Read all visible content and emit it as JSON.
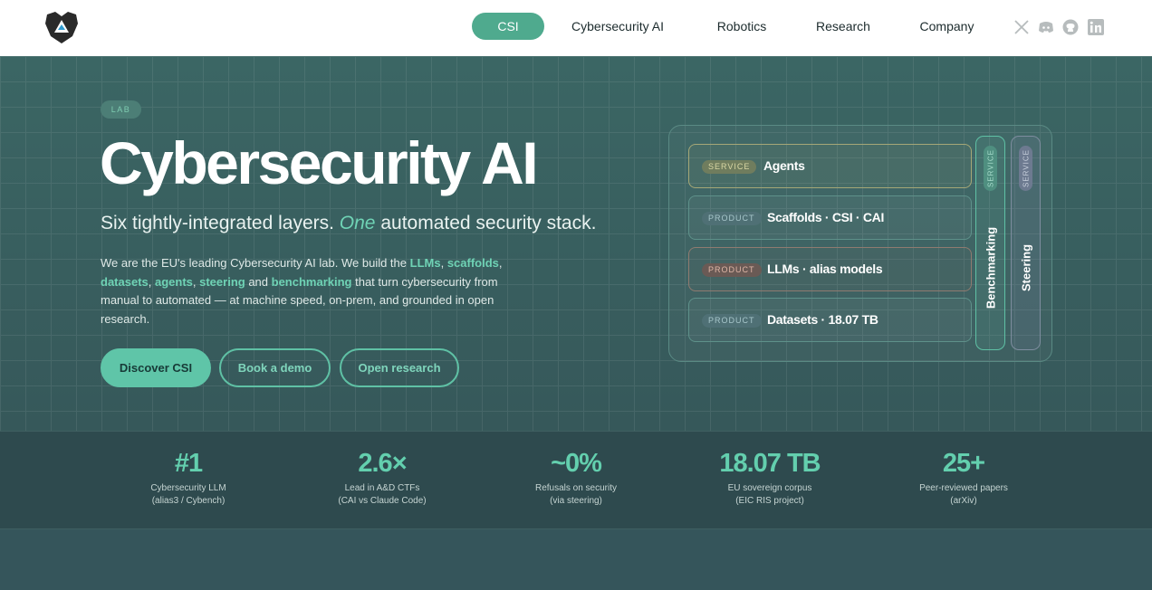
{
  "nav": {
    "items": [
      "CSI",
      "Cybersecurity AI",
      "Robotics",
      "Research",
      "Company"
    ],
    "active": "CSI"
  },
  "social": [
    "x-icon",
    "discord-icon",
    "github-icon",
    "linkedin-icon"
  ],
  "hero": {
    "badge": "LAB",
    "title": "Cybersecurity AI",
    "subtitle_pre": "Six tightly-integrated layers. ",
    "subtitle_em": "One",
    "subtitle_post": " automated security stack.",
    "desc": {
      "t1": "We are the EU's leading Cybersecurity AI lab. We build the ",
      "h1": "LLMs",
      "t2": ", ",
      "h2": "scaffolds",
      "t3": ", ",
      "h3": "datasets",
      "t4": ", ",
      "h4": "agents",
      "t5": ", ",
      "h5": "steering",
      "t6": " and ",
      "h6": "benchmarking",
      "t7": " that turn cybersecurity from manual to automated — at machine speed, on-prem, and grounded in open research."
    },
    "buttons": {
      "discover": "Discover CSI",
      "demo": "Book a demo",
      "research": "Open research"
    }
  },
  "stack": {
    "layers": [
      {
        "tag": "SERVICE",
        "name": "Agents"
      },
      {
        "tag": "PRODUCT",
        "name": "Scaffolds · CSI · CAI"
      },
      {
        "tag": "PRODUCT",
        "name": "LLMs · alias models"
      },
      {
        "tag": "PRODUCT",
        "name": "Datasets · 18.07 TB"
      }
    ],
    "columns": [
      {
        "tag": "SERVICE",
        "name": "Benchmarking"
      },
      {
        "tag": "SERVICE",
        "name": "Steering"
      }
    ]
  },
  "stats": [
    {
      "value": "#1",
      "label1": "Cybersecurity LLM",
      "label2": "(alias3 / Cybench)"
    },
    {
      "value": "2.6×",
      "label1": "Lead in A&D CTFs",
      "label2": "(CAI vs Claude Code)"
    },
    {
      "value": "~0%",
      "label1": "Refusals on security",
      "label2": "(via steering)"
    },
    {
      "value": "18.07 TB",
      "label1": "EU sovereign corpus",
      "label2": "(EIC RIS project)"
    },
    {
      "value": "25+",
      "label1": "Peer-reviewed papers",
      "label2": "(arXiv)"
    }
  ],
  "colors": {
    "accent": "#5fc5a8",
    "hero_bg": "#3b6664",
    "stats_bg": "#2e4a4e"
  }
}
